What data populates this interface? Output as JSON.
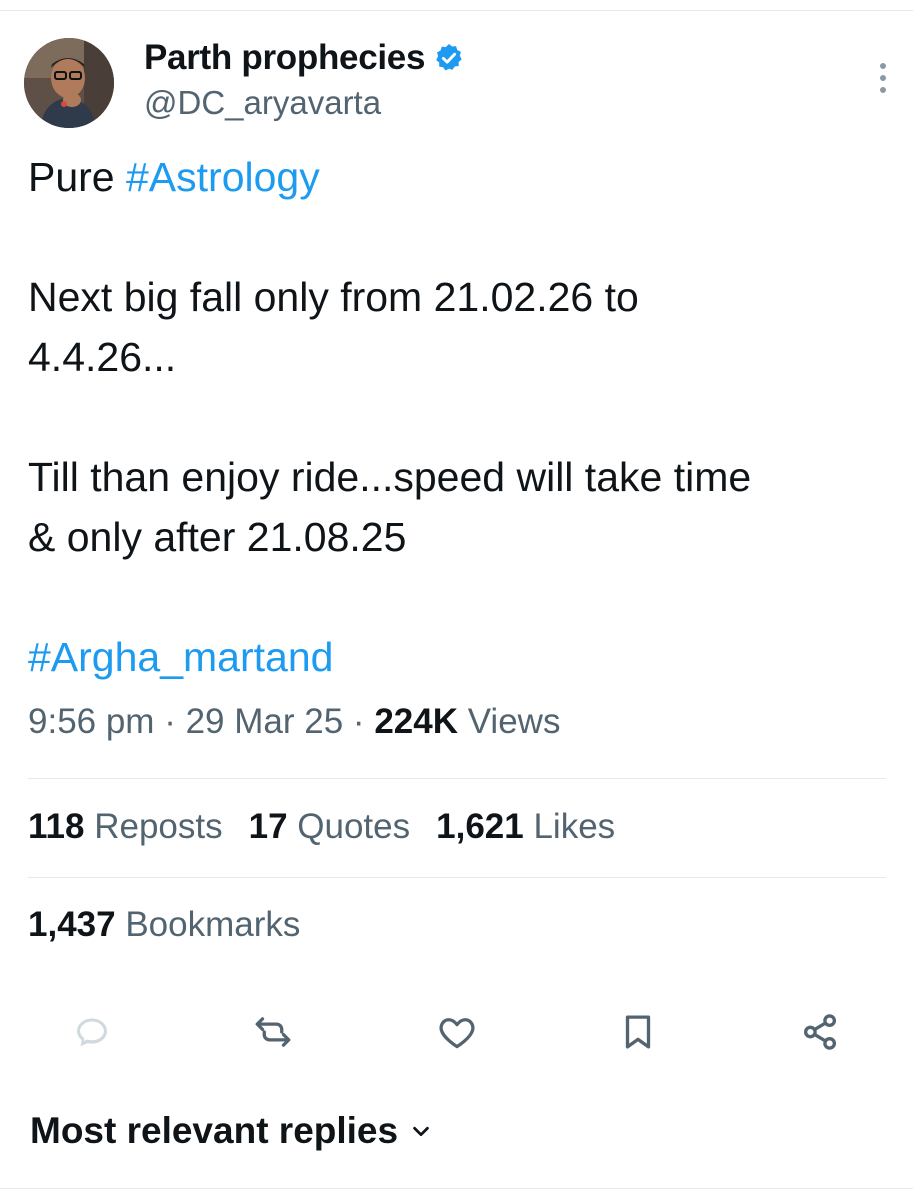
{
  "tweet": {
    "author_name": "Parth prophecies",
    "handle": "@DC_aryavarta",
    "verified_icon": "verified-badge-icon",
    "lines": {
      "l1_plain": "Pure ",
      "l1_tag": "#Astrology",
      "l2": "Next big fall only from 21.02.26 to",
      "l3": "4.4.26...",
      "l4": "Till than enjoy ride...speed will take time",
      "l5": "& only after 21.08.25",
      "l6_tag": "#Argha_martand"
    },
    "time": "9:56 pm",
    "sep": "·",
    "date": "29 Mar 25",
    "views_count": "224K",
    "views_label": "Views"
  },
  "stats": {
    "reposts_count": "118",
    "reposts_label": "Reposts",
    "quotes_count": "17",
    "quotes_label": "Quotes",
    "likes_count": "1,621",
    "likes_label": "Likes",
    "bookmarks_count": "1,437",
    "bookmarks_label": "Bookmarks"
  },
  "actions": [
    "reply-icon",
    "repost-icon",
    "like-icon",
    "bookmark-icon",
    "share-icon"
  ],
  "replies_sort": "Most relevant replies",
  "colors": {
    "accent": "#1d9bf0",
    "secondary_text": "#536471",
    "text": "#0f1419",
    "icon": "#536471"
  }
}
